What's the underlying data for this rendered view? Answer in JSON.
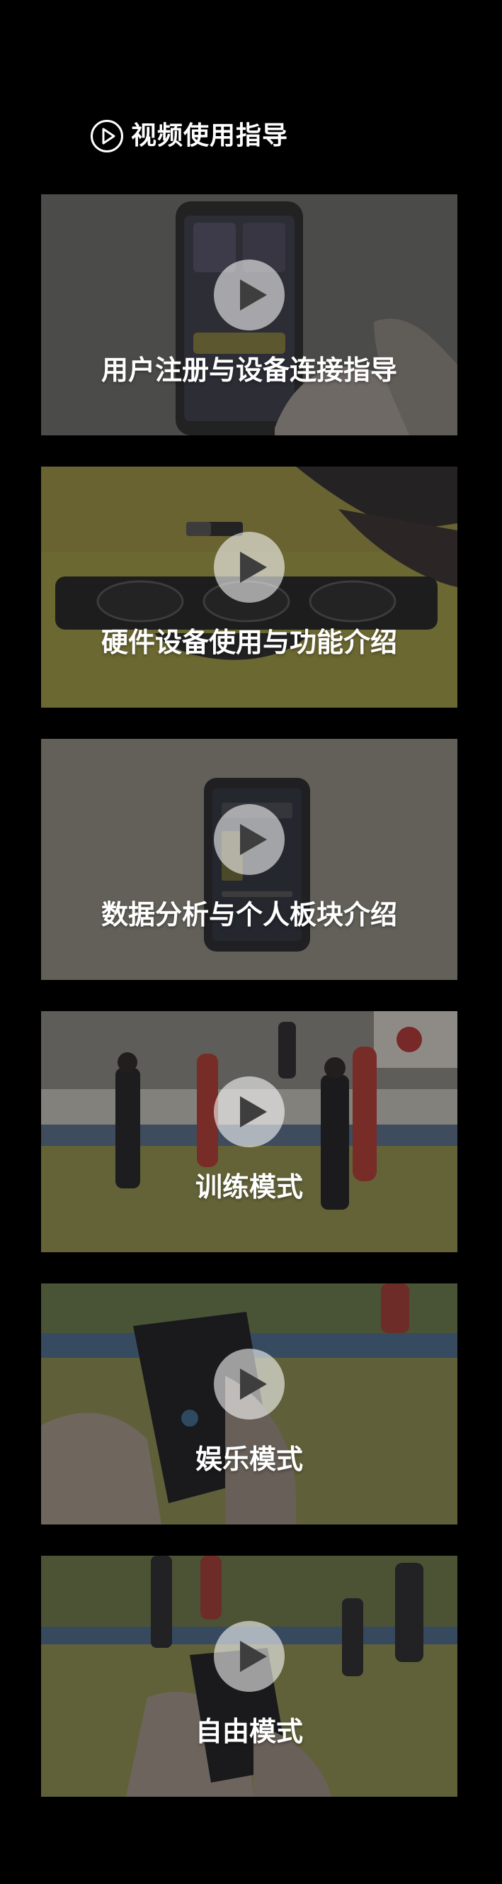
{
  "header": {
    "icon": "play-circle-icon",
    "title": "视频使用指导"
  },
  "videos": [
    {
      "title": "用户注册与设备连接指导",
      "icon": "play-icon",
      "thumbnail": "hand-holding-phone-app",
      "tint": "#6f6f6c"
    },
    {
      "title": "硬件设备使用与功能介绍",
      "icon": "play-icon",
      "thumbnail": "training-pad-on-floor",
      "tint": "#9a9441"
    },
    {
      "title": "数据分析与个人板块介绍",
      "icon": "play-icon",
      "thumbnail": "phone-on-table",
      "tint": "#8d8b82"
    },
    {
      "title": "训练模式",
      "icon": "play-icon",
      "thumbnail": "athletes-in-gym",
      "tint": "#6f7a44"
    },
    {
      "title": "娱乐模式",
      "icon": "play-icon",
      "thumbnail": "hands-holding-phone",
      "tint": "#6b6f46"
    },
    {
      "title": "自由模式",
      "icon": "play-icon",
      "thumbnail": "phone-in-gym",
      "tint": "#6f7245"
    }
  ]
}
